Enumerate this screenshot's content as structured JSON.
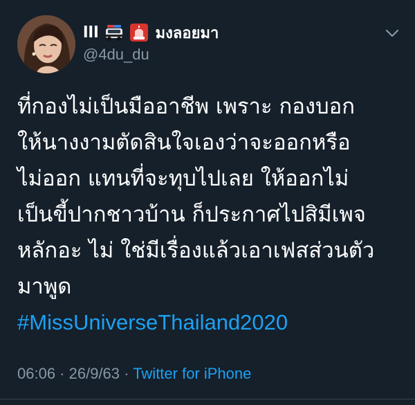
{
  "tweet": {
    "author": {
      "prefix": "lll",
      "name": "มงลอยมา",
      "handle": "@4du_du",
      "emoji_1": "police-car-icon",
      "emoji_2": "siren-light-icon"
    },
    "lines": [
      "ที่กองไม่เป็นมืออาชีพ เพราะ กองบอก",
      "ให้นางงามตัดสินใจเองว่าจะออกหรือ",
      "ไม่ออก แทนที่จะทุบไปเลย ให้ออกไม่",
      "เป็นขี้ปากชาวบ้าน ก็ประกาศไปสิมีเพจ",
      "หลักอะ ไม่ ใช่มีเรื่องแล้วเอาเฟสส่วนตัว",
      "มาพูด"
    ],
    "hashtag": "#MissUniverseThailand2020",
    "time": "06:06",
    "date": "26/9/63",
    "separator": " · ",
    "source": "Twitter for iPhone"
  },
  "colors": {
    "background": "#15202b",
    "text": "#ffffff",
    "muted": "#8899a6",
    "link": "#1da1f2"
  }
}
